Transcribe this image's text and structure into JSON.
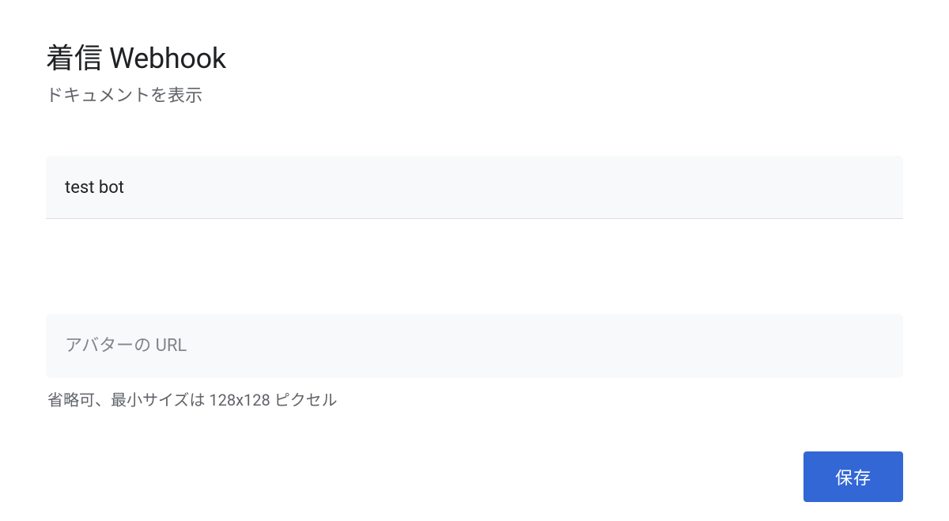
{
  "header": {
    "title": "着信 Webhook",
    "docs_link_label": "ドキュメントを表示"
  },
  "name_field": {
    "value": "test bot",
    "placeholder": ""
  },
  "avatar_field": {
    "value": "",
    "placeholder": "アバターの URL",
    "help_text": "省略可、最小サイズは 128x128 ピクセル"
  },
  "actions": {
    "save_label": "保存"
  }
}
